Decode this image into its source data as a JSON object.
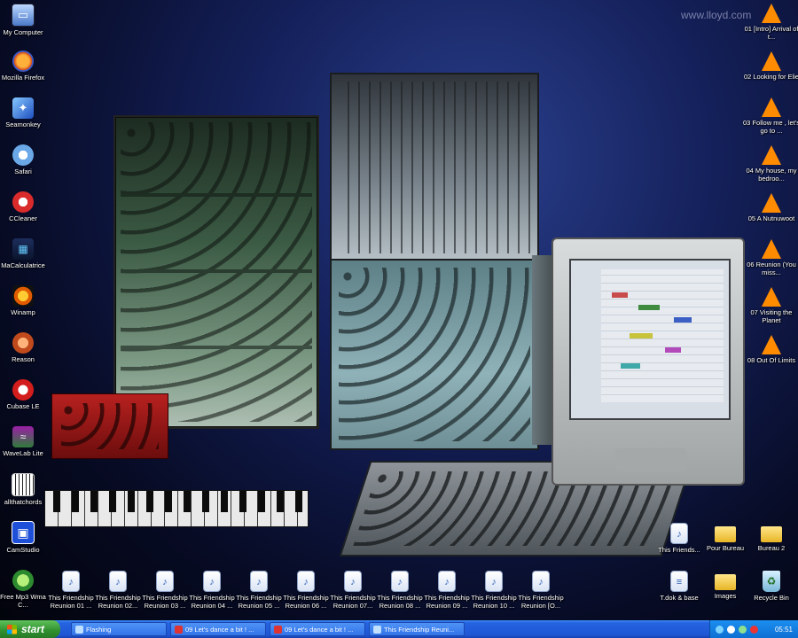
{
  "watermark": "www.lloyd.com",
  "left_icons": [
    {
      "label": "My Computer",
      "icon": "computer-icon"
    },
    {
      "label": "Mozilla Firefox",
      "icon": "firefox-icon"
    },
    {
      "label": "Seamonkey",
      "icon": "seamonkey-icon"
    },
    {
      "label": "Safari",
      "icon": "safari-icon"
    },
    {
      "label": "CCleaner",
      "icon": "ccleaner-icon"
    },
    {
      "label": "MaCalculatrice",
      "icon": "calculator-icon"
    },
    {
      "label": "Winamp",
      "icon": "winamp-icon"
    },
    {
      "label": "Reason",
      "icon": "reason-icon"
    },
    {
      "label": "Cubase LE",
      "icon": "cubase-icon"
    },
    {
      "label": "WaveLab Lite",
      "icon": "wavelab-icon"
    },
    {
      "label": "allthatchords",
      "icon": "piano-icon"
    },
    {
      "label": "CamStudio",
      "icon": "camstudio-icon"
    },
    {
      "label": "Free Mp3 Wma C...",
      "icon": "mp3-converter-icon"
    }
  ],
  "right_icons": [
    {
      "label": "01 [Intro] Arrival of t...",
      "icon": "vlc-icon"
    },
    {
      "label": "02 Looking for Elie",
      "icon": "vlc-icon"
    },
    {
      "label": "03 Follow me , let's go to ...",
      "icon": "vlc-icon"
    },
    {
      "label": "04 My house, my bedroo...",
      "icon": "vlc-icon"
    },
    {
      "label": "05 A Nutnuwoot",
      "icon": "vlc-icon"
    },
    {
      "label": "06 Reunion (You miss...",
      "icon": "vlc-icon"
    },
    {
      "label": "07 Visiting the Planet",
      "icon": "vlc-icon"
    },
    {
      "label": "08 Out Of Limits",
      "icon": "vlc-icon"
    }
  ],
  "bottom_files": [
    {
      "label": "This Friendship Reunion 01 ..."
    },
    {
      "label": "This Friendship Reunion 02..."
    },
    {
      "label": "This Friendship Reunion 03 ..."
    },
    {
      "label": "This Friendship Reunion 04 ..."
    },
    {
      "label": "This Friendship Reunion 05 ..."
    },
    {
      "label": "This Friendship Reunion 06 ..."
    },
    {
      "label": "This Friendship Reunion 07..."
    },
    {
      "label": "This Friendship Reunion 08 ..."
    },
    {
      "label": "This Friendship Reunion 09 ..."
    },
    {
      "label": "This Friendship Reunion 10 ..."
    },
    {
      "label": "This Friendship Reunion [O..."
    }
  ],
  "corner_icons": {
    "friends": {
      "label": "This Friends..."
    },
    "pour_bureau": {
      "label": "Pour Bureau"
    },
    "bureau2": {
      "label": "Bureau 2"
    },
    "tdok": {
      "label": "T.dok & base"
    },
    "images": {
      "label": "Images"
    },
    "recycle": {
      "label": "Recycle Bin"
    }
  },
  "taskbar": {
    "start_label": "start",
    "tasks": [
      {
        "label": "Flashing"
      },
      {
        "label": "09 Let's dance a bit ! ..."
      },
      {
        "label": "09 Let's dance a bit ! ..."
      },
      {
        "label": "This Friendship Reuni..."
      }
    ],
    "clock": "05:51"
  }
}
